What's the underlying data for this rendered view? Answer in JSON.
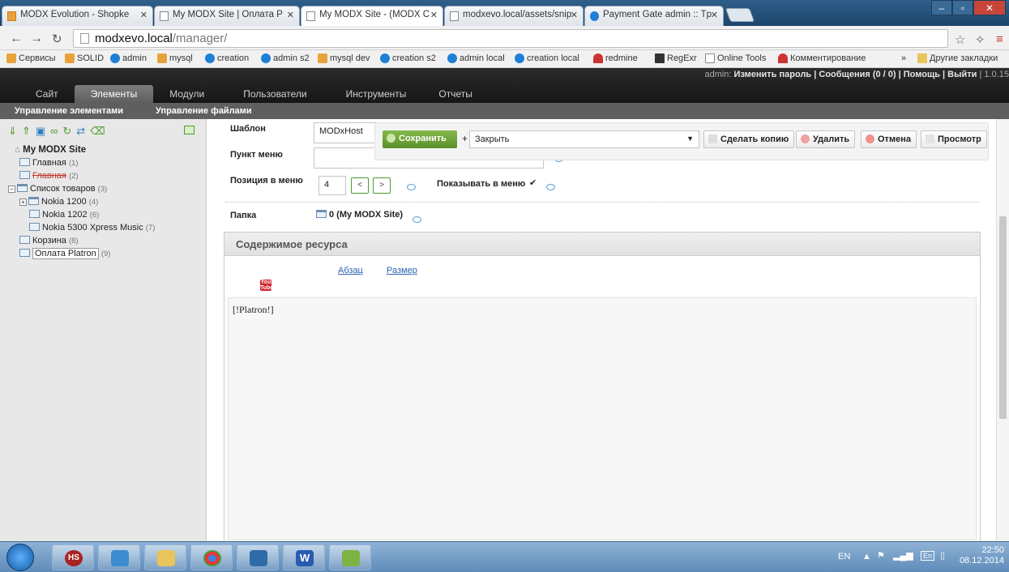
{
  "browser": {
    "tabs": [
      {
        "label": "MODX Evolution - Shopke",
        "icon": "modx-icon"
      },
      {
        "label": "My MODX Site | Оплата P",
        "icon": "page-icon"
      },
      {
        "label": "My MODX Site - (MODX C",
        "icon": "page-icon"
      },
      {
        "label": "modxevo.local/assets/snip",
        "icon": "page-icon"
      },
      {
        "label": "Payment Gate admin :: Tp",
        "icon": "pg-icon"
      }
    ],
    "url_host": "modxevo.local",
    "url_path": "/manager/",
    "bookmarks": [
      "Сервисы",
      "SOLID",
      "admin",
      "mysql",
      "creation",
      "admin s2",
      "mysql dev",
      "creation s2",
      "admin local",
      "creation local",
      "redmine",
      "RegExr",
      "Online Tools",
      "Комментирование",
      "»",
      "Другие закладки"
    ]
  },
  "modx": {
    "user_bar": {
      "prefix": "admin:",
      "links": "Изменить пароль | Сообщения (0 / 0) | Помощь | Выйти",
      "version": "| 1.0.15"
    },
    "main_nav": [
      "Сайт",
      "Элементы",
      "Модули",
      "Пользователи",
      "Инструменты",
      "Отчеты"
    ],
    "active_nav": "Элементы",
    "sub_nav": [
      "Управление элементами",
      "Управление файлами"
    ]
  },
  "tree": {
    "root": "My MODX Site",
    "nodes": [
      {
        "name": "Главная",
        "id": "(1)"
      },
      {
        "name": "Главная",
        "id": "(2)"
      },
      {
        "name": "Список товаров",
        "id": "(3)"
      },
      {
        "name": "Nokia 1200",
        "id": "(4)"
      },
      {
        "name": "Nokia 1202",
        "id": "(6)"
      },
      {
        "name": "Nokia 5300 Xpress Music",
        "id": "(7)"
      },
      {
        "name": "Корзина",
        "id": "(8)"
      },
      {
        "name": "Оплата Platron",
        "id": "(9)"
      }
    ]
  },
  "form": {
    "template_label": "Шаблон",
    "template_value": "MODxHost",
    "menu_item_label": "Пункт меню",
    "menu_item_value": "",
    "menu_pos_label": "Позиция в меню",
    "menu_pos_value": "4",
    "prev": "<",
    "next": ">",
    "show_in_menu_label": "Показывать в меню",
    "show_in_menu_checked": "✔",
    "folder_label": "Папка",
    "folder_value": "0 (My MODX Site)"
  },
  "actions": {
    "save": "Сохранить",
    "plus": "+",
    "after_save": "Закрыть",
    "copy": "Сделать копию",
    "delete": "Удалить",
    "cancel": "Отмена",
    "preview": "Просмотр"
  },
  "content_panel": {
    "title": "Содержимое ресурса",
    "format_link": "Абзац",
    "size_link": "Размер",
    "youtube_top": "You",
    "youtube_bottom": "Tube",
    "body": "[!Platron!]"
  },
  "taskbar": {
    "apps": [
      "HS",
      "",
      "",
      "",
      "",
      "W",
      ""
    ],
    "lang": "EN",
    "tray_lang": "En",
    "time": "22:50",
    "date": "08.12.2014"
  }
}
